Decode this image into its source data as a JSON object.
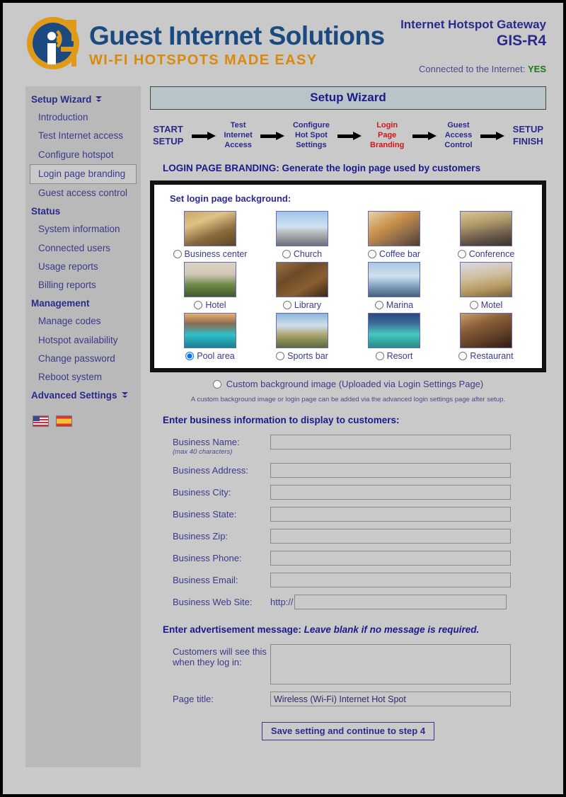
{
  "brand": {
    "logo_title": "Guest Internet Solutions",
    "logo_subtitle": "WI-FI HOTSPOTS MADE EASY",
    "device_line1": "Internet Hotspot Gateway",
    "device_line2": "GIS-R4",
    "connection_label": "Connected to the Internet:",
    "connection_value": "YES",
    "colors": {
      "brand_blue": "#1b4a80",
      "brand_orange": "#d98a0b",
      "heading_navy": "#2a2a8c",
      "status_green": "#1a7a1a",
      "current_step_red": "#d4151c"
    }
  },
  "sidebar": {
    "groups": [
      {
        "title": "Setup Wizard",
        "caret": "☰",
        "items": [
          {
            "label": "Introduction",
            "active": false
          },
          {
            "label": "Test Internet access",
            "active": false
          },
          {
            "label": "Configure hotspot",
            "active": false
          },
          {
            "label": "Login page branding",
            "active": true
          },
          {
            "label": "Guest access control",
            "active": false
          }
        ]
      },
      {
        "title": "Status",
        "caret": "",
        "items": [
          {
            "label": "System information",
            "active": false
          },
          {
            "label": "Connected users",
            "active": false
          },
          {
            "label": "Usage reports",
            "active": false
          },
          {
            "label": "Billing reports",
            "active": false
          }
        ]
      },
      {
        "title": "Management",
        "caret": "",
        "items": [
          {
            "label": "Manage codes",
            "active": false
          },
          {
            "label": "Hotspot availability",
            "active": false
          },
          {
            "label": "Change password",
            "active": false
          },
          {
            "label": "Reboot system",
            "active": false
          }
        ]
      },
      {
        "title": "Advanced Settings",
        "caret": "☰",
        "items": []
      }
    ],
    "languages": [
      {
        "name": "us-flag-icon",
        "title": "English"
      },
      {
        "name": "es-flag-icon",
        "title": "Español"
      }
    ]
  },
  "main": {
    "title_bar": "Setup Wizard",
    "steps": [
      {
        "label": "START\nSETUP",
        "current": false,
        "big": true
      },
      {
        "label": "Test\nInternet\nAccess",
        "current": false,
        "big": false
      },
      {
        "label": "Configure\nHot Spot\nSettings",
        "current": false,
        "big": false
      },
      {
        "label": "Login\nPage\nBranding",
        "current": true,
        "big": false
      },
      {
        "label": "Guest\nAccess\nControl",
        "current": false,
        "big": false
      },
      {
        "label": "SETUP\nFINISH",
        "current": false,
        "big": true
      }
    ],
    "section_heading": "LOGIN PAGE BRANDING: Generate the login page used by customers",
    "background_panel": {
      "title": "Set login page background:",
      "options": [
        {
          "label": "Business center",
          "selected": false,
          "thumb": "business-center"
        },
        {
          "label": "Church",
          "selected": false,
          "thumb": "church"
        },
        {
          "label": "Coffee bar",
          "selected": false,
          "thumb": "coffee-bar"
        },
        {
          "label": "Conference",
          "selected": false,
          "thumb": "conference"
        },
        {
          "label": "Hotel",
          "selected": false,
          "thumb": "hotel"
        },
        {
          "label": "Library",
          "selected": false,
          "thumb": "library"
        },
        {
          "label": "Marina",
          "selected": false,
          "thumb": "marina"
        },
        {
          "label": "Motel",
          "selected": false,
          "thumb": "motel"
        },
        {
          "label": "Pool area",
          "selected": true,
          "thumb": "pool-area"
        },
        {
          "label": "Sports bar",
          "selected": false,
          "thumb": "sports-bar"
        },
        {
          "label": "Resort",
          "selected": false,
          "thumb": "resort"
        },
        {
          "label": "Restaurant",
          "selected": false,
          "thumb": "restaurant"
        }
      ]
    },
    "custom_option": {
      "label": "Custom background image (Uploaded via Login Settings Page)",
      "selected": false
    },
    "custom_note": "A custom background image or login page can be added via the advanced login settings page after setup.",
    "business_heading": "Enter business information to display to customers:",
    "business_fields": [
      {
        "label": "Business Name:",
        "sub": "(max 40 characters)",
        "value": "",
        "prefix": ""
      },
      {
        "label": "Business Address:",
        "sub": "",
        "value": "",
        "prefix": ""
      },
      {
        "label": "Business City:",
        "sub": "",
        "value": "",
        "prefix": ""
      },
      {
        "label": "Business State:",
        "sub": "",
        "value": "",
        "prefix": ""
      },
      {
        "label": "Business Zip:",
        "sub": "",
        "value": "",
        "prefix": ""
      },
      {
        "label": "Business Phone:",
        "sub": "",
        "value": "",
        "prefix": ""
      },
      {
        "label": "Business Email:",
        "sub": "",
        "value": "",
        "prefix": ""
      },
      {
        "label": "Business Web Site:",
        "sub": "",
        "value": "",
        "prefix": "http://"
      }
    ],
    "ad_heading_bold": "Enter advertisement message:",
    "ad_heading_italic": "Leave blank if no message is required.",
    "ad_label": "Customers will see this when they log in:",
    "ad_value": "",
    "page_title_label": "Page title:",
    "page_title_value": "Wireless (Wi-Fi) Internet Hot Spot",
    "save_button": "Save setting and continue to step 4"
  }
}
